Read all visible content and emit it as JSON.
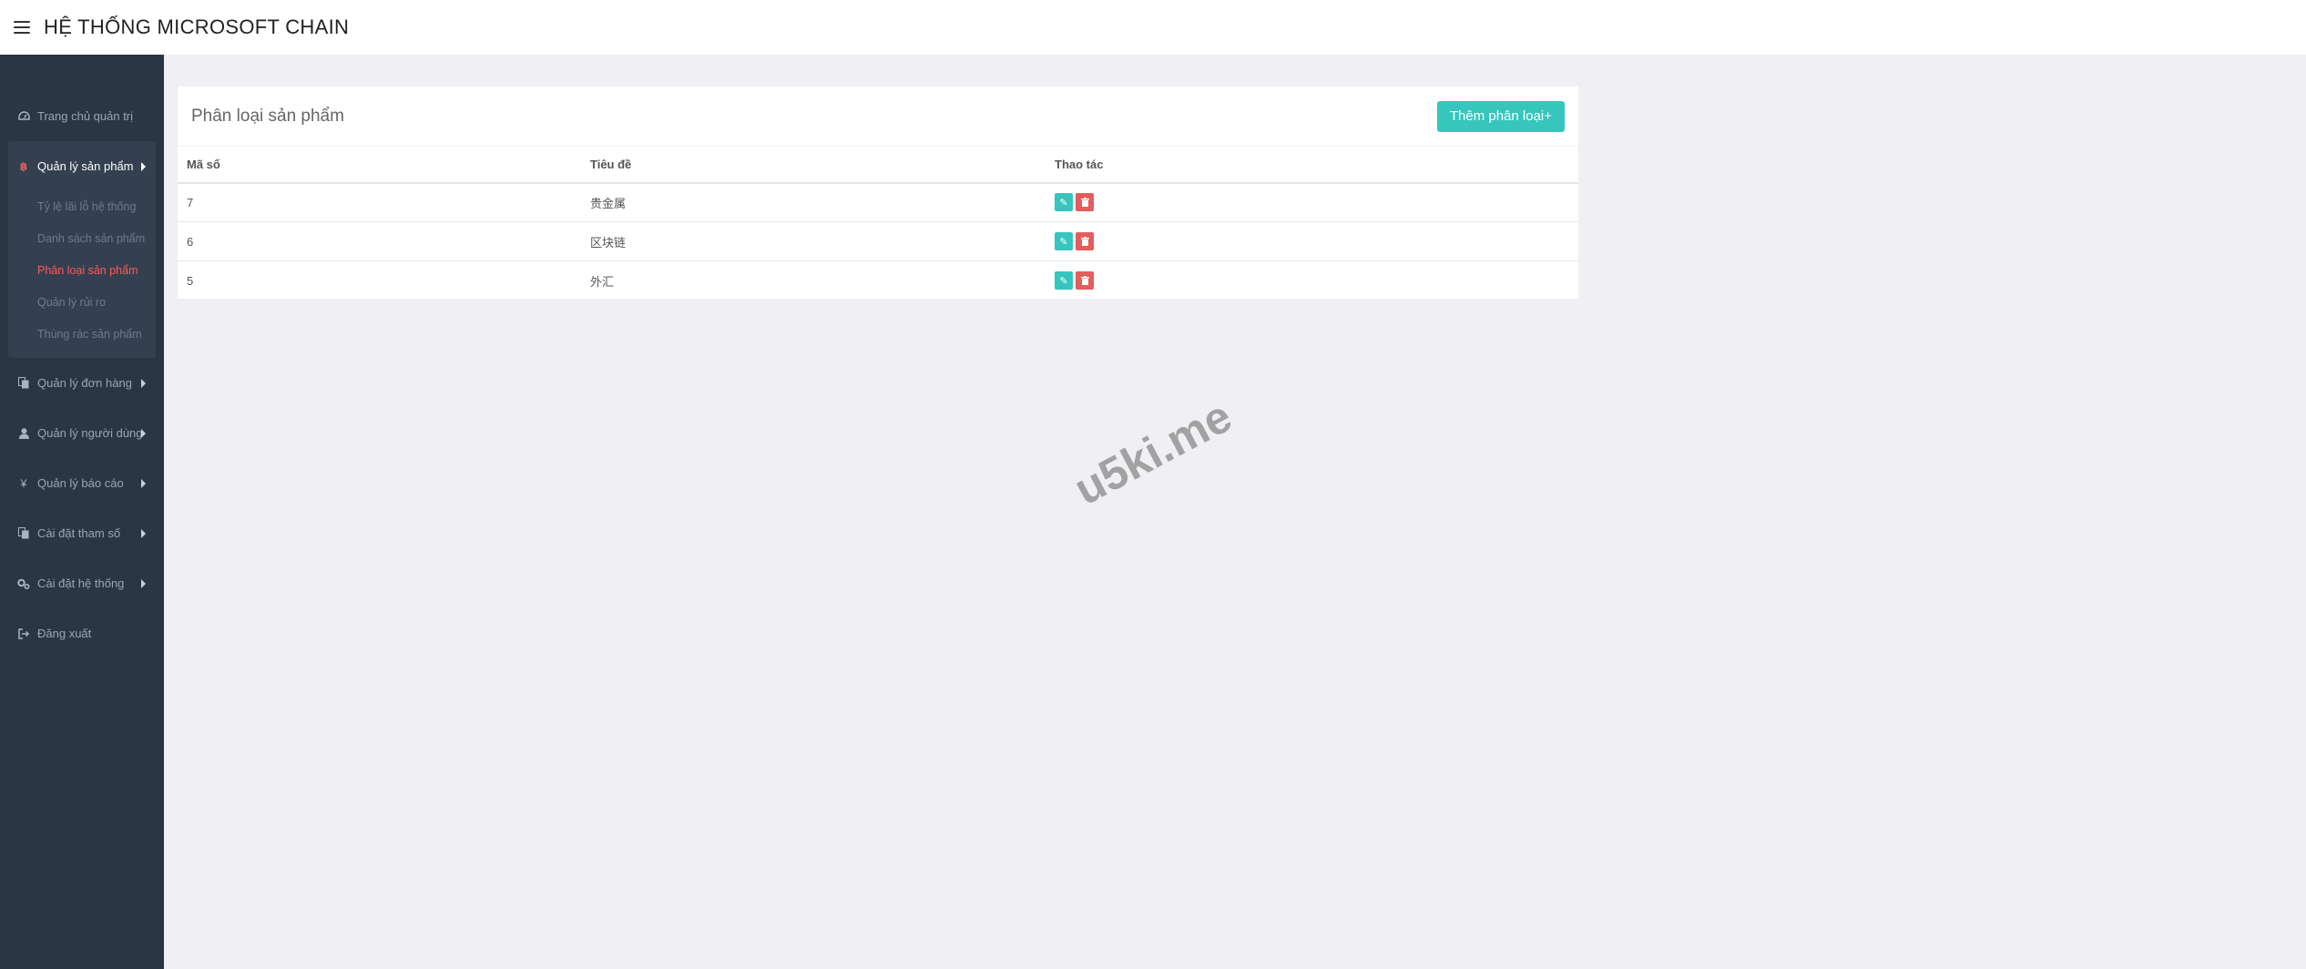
{
  "app": {
    "title": "HỆ THỐNG MICROSOFT CHAIN"
  },
  "sidebar": {
    "items": [
      {
        "label": "Trang chủ quản trị",
        "icon": "dashboard-icon"
      },
      {
        "label": "Quản lý sản phẩm",
        "icon": "bitcoin-icon",
        "expanded": true,
        "children": [
          {
            "label": "Tỷ lệ lãi lỗ hệ thống",
            "active": false
          },
          {
            "label": "Danh sách sản phẩm",
            "active": false
          },
          {
            "label": "Phân loại sản phẩm",
            "active": true
          },
          {
            "label": "Quản lý rủi ro",
            "active": false
          },
          {
            "label": "Thùng rác sản phẩm",
            "active": false
          }
        ]
      },
      {
        "label": "Quản lý đơn hàng",
        "icon": "copy-icon"
      },
      {
        "label": "Quản lý người dùng",
        "icon": "user-icon"
      },
      {
        "label": "Quản lý báo cáo",
        "icon": "yen-icon"
      },
      {
        "label": "Cài đặt tham số",
        "icon": "copy-icon"
      },
      {
        "label": "Cài đặt hệ thống",
        "icon": "gears-icon"
      },
      {
        "label": "Đăng xuất",
        "icon": "sign-out-icon"
      }
    ]
  },
  "main": {
    "title": "Phân loại sản phẩm",
    "add_button": "Thêm phân loại+",
    "table": {
      "headers": [
        "Mã số",
        "Tiêu đề",
        "Thao tác"
      ],
      "rows": [
        {
          "id": "7",
          "title": "贵金属"
        },
        {
          "id": "6",
          "title": "区块链"
        },
        {
          "id": "5",
          "title": "外汇"
        }
      ]
    }
  },
  "watermark": "u5ki.me",
  "colors": {
    "accent": "#36c6bd",
    "danger": "#e45c5c",
    "active_link": "#ff5a5a",
    "sidebar_bg": "#2b3643"
  }
}
